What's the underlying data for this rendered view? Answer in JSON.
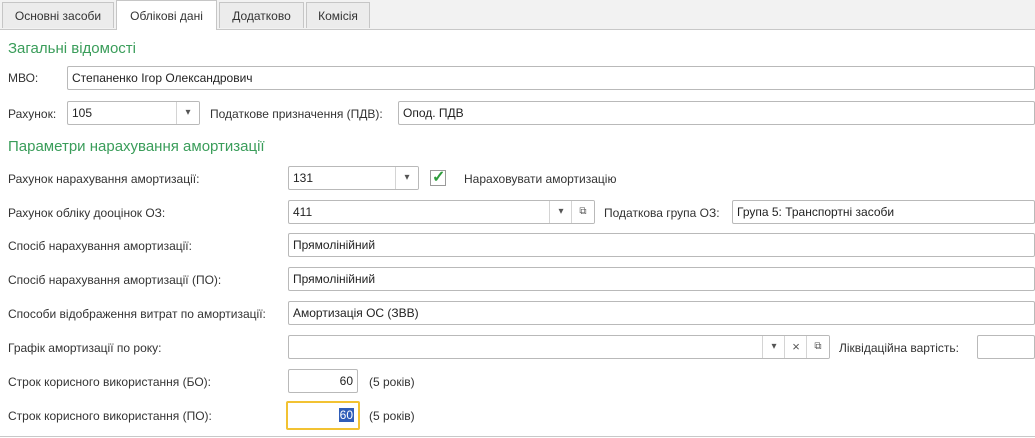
{
  "tabs": [
    "Основні засоби",
    "Облікові дані",
    "Додатково",
    "Комісія"
  ],
  "active_tab": "Облікові дані",
  "general": {
    "title": "Загальні відомості",
    "mvo_label": "МВО:",
    "mvo_value": "Степаненко Ігор Олександрович",
    "account_label": "Рахунок:",
    "account_value": "105",
    "tax_purpose_label": "Податкове призначення (ПДВ):",
    "tax_purpose_value": "Опод. ПДВ"
  },
  "depreciation": {
    "title": "Параметри нарахування амортизації",
    "dep_account_label": "Рахунок нарахування амортизації:",
    "dep_account_value": "131",
    "accrue_label": "Нараховувати амортизацію",
    "accrue_checked": true,
    "reval_account_label": "Рахунок обліку дооцінок ОЗ:",
    "reval_account_value": "411",
    "tax_group_label": "Податкова група ОЗ:",
    "tax_group_value": "Група 5: Транспортні засоби",
    "method_label": "Спосіб нарахування амортизації:",
    "method_value": "Прямолінійний",
    "method_po_label": "Спосіб нарахування амортизації (ПО):",
    "method_po_value": "Прямолінійний",
    "expense_label": "Способи відображення витрат по амортизації:",
    "expense_value": "Амортизація ОС (ЗВВ)",
    "schedule_label": "Графік амортизації по року:",
    "schedule_value": "",
    "liquidation_label": "Ліквідаційна вартість:",
    "liquidation_value": "",
    "useful_life_bo_label": "Строк корисного використання (БО):",
    "useful_life_bo_value": "60",
    "useful_life_bo_years": "(5 років)",
    "useful_life_po_label": "Строк корисного використання (ПО):",
    "useful_life_po_value": "60",
    "useful_life_po_years": "(5 років)"
  },
  "icons": {
    "dropdown": "▾",
    "open": "⧉",
    "clear": "×",
    "check": "✓"
  }
}
